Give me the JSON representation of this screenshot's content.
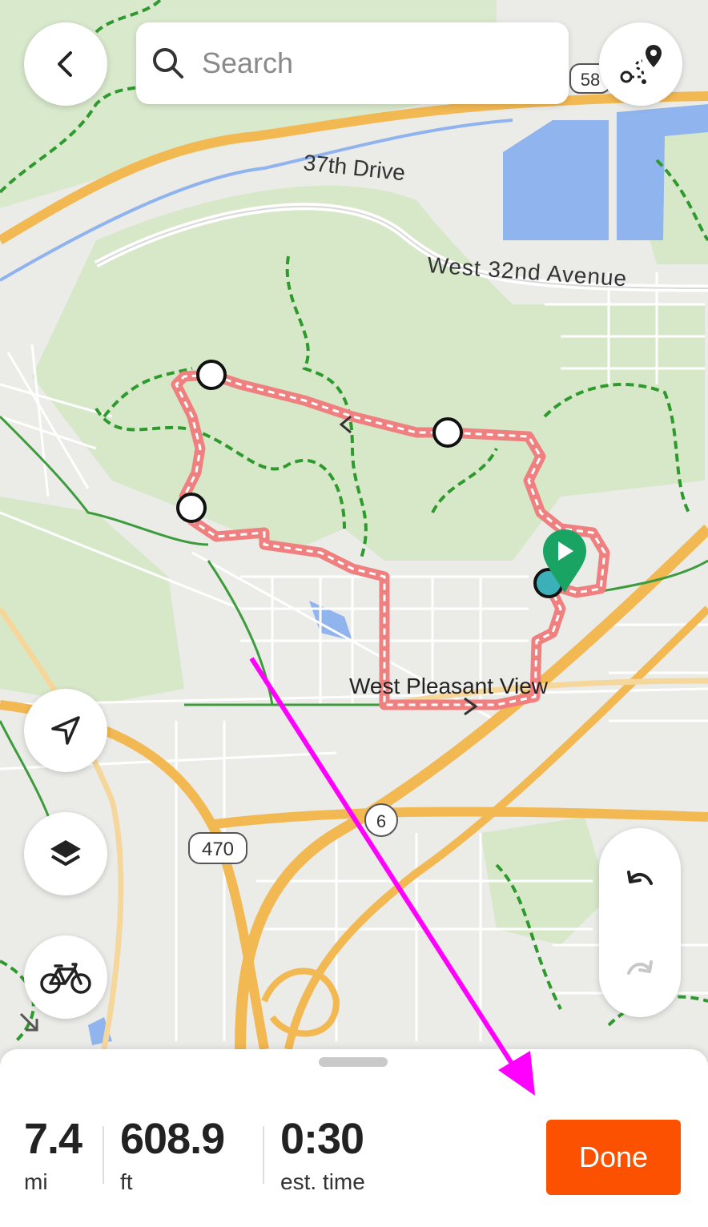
{
  "search": {
    "placeholder": "Search"
  },
  "map": {
    "labels": {
      "drive_37th": "37th Drive",
      "west_32nd": "West 32nd Avenue",
      "west_pleasant_view": "West Pleasant View",
      "route_6": "6",
      "route_470": "470",
      "route_58": "58"
    },
    "colors": {
      "route": "#f08080",
      "highway": "#f2b852",
      "trail": "#2e9a2e",
      "park": "#d5e6c7",
      "water": "#8fb3ef",
      "start_pin": "#19a463"
    }
  },
  "icons": {
    "back": "chevron-left-icon",
    "search": "search-icon",
    "route_builder": "route-pin-icon",
    "locate": "navigation-arrow-icon",
    "layers": "layers-icon",
    "sport": "bicycle-icon",
    "undo": "undo-icon",
    "redo": "redo-icon"
  },
  "stats": {
    "distance": {
      "value": "7.4",
      "unit": "mi"
    },
    "elevation": {
      "value": "608.9",
      "unit": "ft"
    },
    "time": {
      "value": "0:30",
      "unit": "est. time"
    }
  },
  "done_label": "Done",
  "accent_color": "#fc5200"
}
